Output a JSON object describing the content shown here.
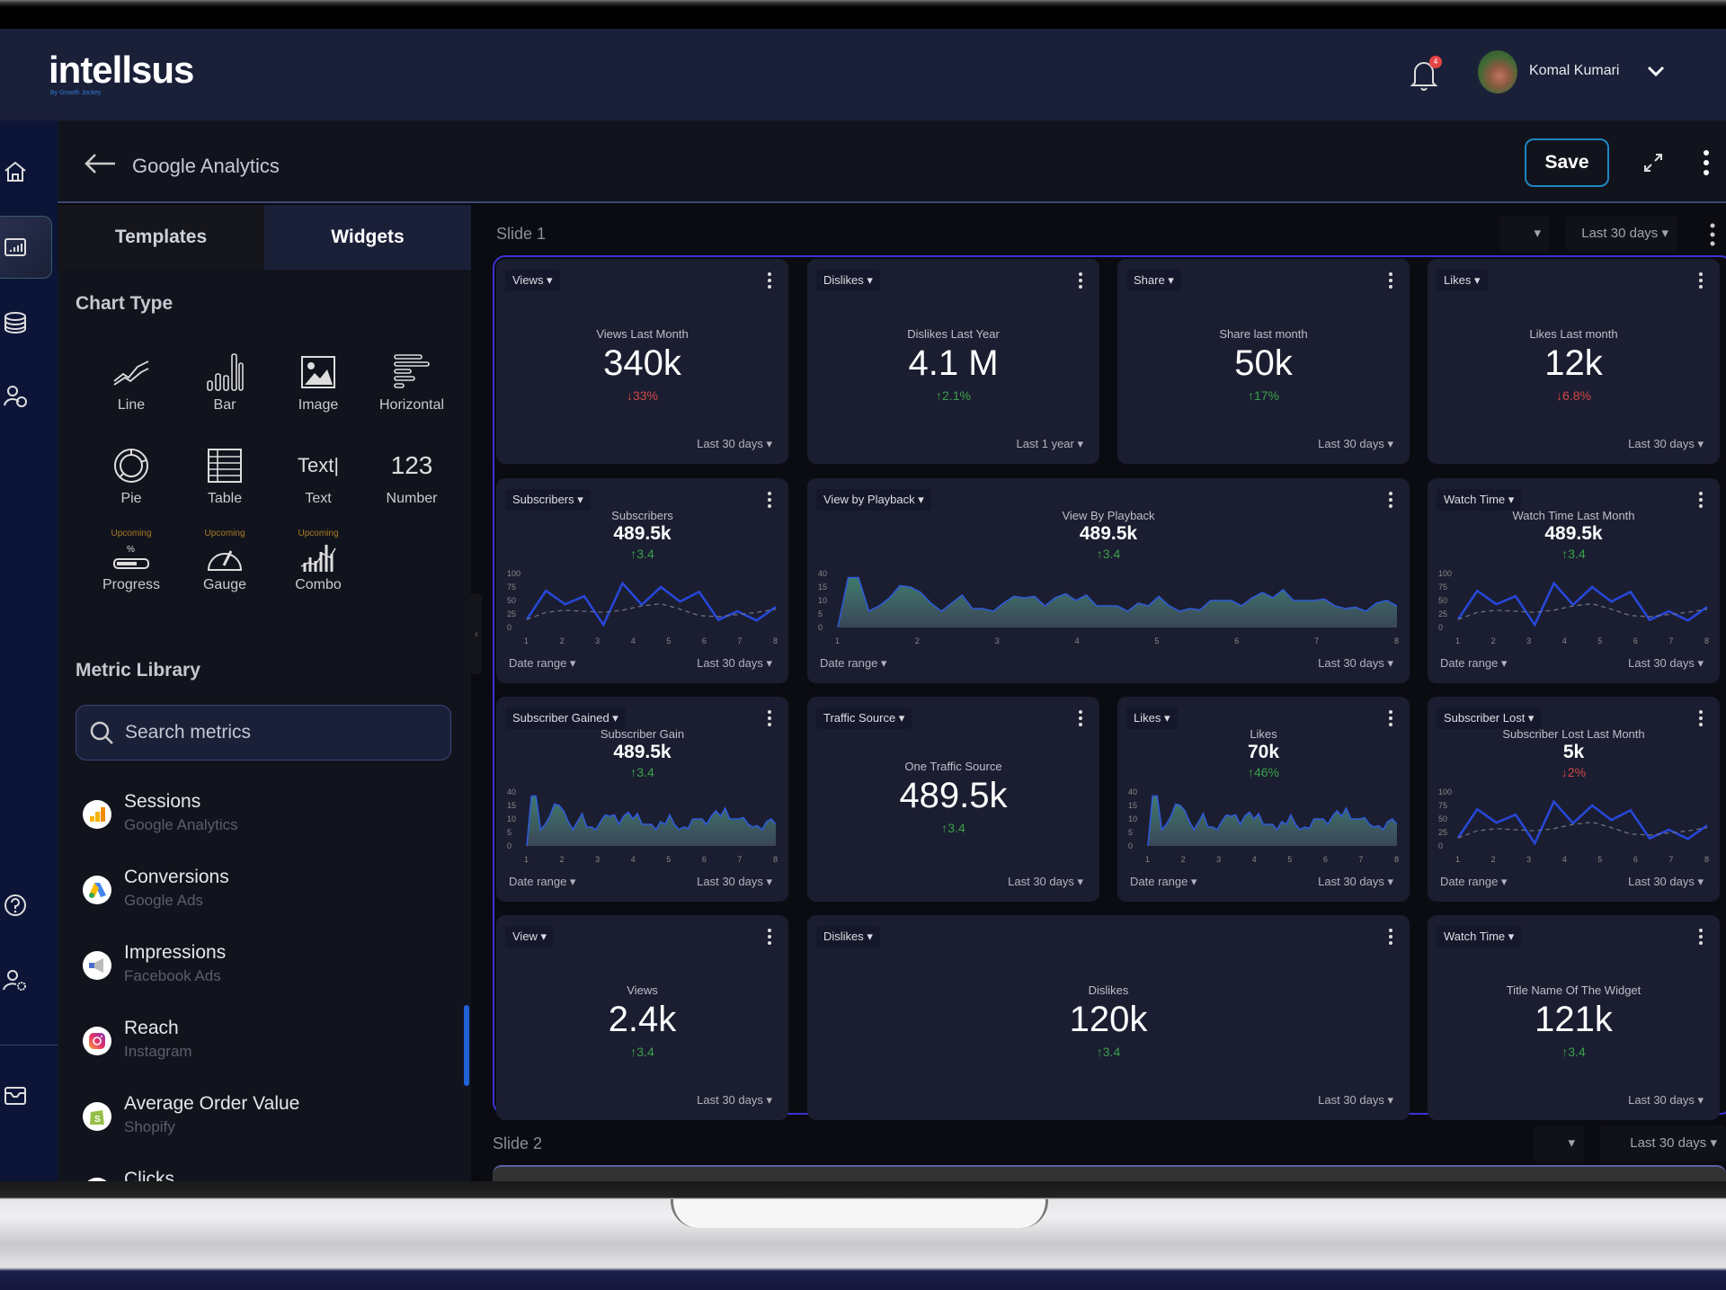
{
  "app": {
    "logo_text": "intellsus",
    "logo_sub": "By Growth Jockey",
    "notification_count": "4",
    "user_name": "Komal Kumari"
  },
  "header": {
    "title": "Google Analytics",
    "save_label": "Save"
  },
  "nav": {
    "items": [
      "home",
      "dashboards",
      "data-sources",
      "team",
      "help",
      "user-settings",
      "inbox"
    ],
    "active": "dashboards"
  },
  "left_panel": {
    "tabs": [
      {
        "label": "Templates",
        "active": false
      },
      {
        "label": "Widgets",
        "active": true
      }
    ],
    "chart_type_title": "Chart Type",
    "chart_types": [
      {
        "label": "Line",
        "icon": "line-chart-icon",
        "upcoming": ""
      },
      {
        "label": "Bar",
        "icon": "bar-chart-icon",
        "upcoming": ""
      },
      {
        "label": "Image",
        "icon": "image-icon",
        "upcoming": ""
      },
      {
        "label": "Horizontal",
        "icon": "horizontal-bar-icon",
        "upcoming": ""
      },
      {
        "label": "Pie",
        "icon": "pie-chart-icon",
        "upcoming": ""
      },
      {
        "label": "Table",
        "icon": "table-icon",
        "upcoming": ""
      },
      {
        "label": "Text",
        "icon": "text-icon",
        "icon_text": "Text|",
        "upcoming": ""
      },
      {
        "label": "Number",
        "icon": "number-icon",
        "icon_text": "123",
        "upcoming": ""
      },
      {
        "label": "Progress",
        "icon": "progress-icon",
        "upcoming": "Upcoming"
      },
      {
        "label": "Gauge",
        "icon": "gauge-icon",
        "upcoming": "Upcoming"
      },
      {
        "label": "Combo",
        "icon": "combo-chart-icon",
        "upcoming": "Upcoming"
      }
    ],
    "metric_library_title": "Metric Library",
    "search_placeholder": "Search metrics",
    "metrics": [
      {
        "name": "Sessions",
        "source": "Google Analytics",
        "icon": "google-analytics-icon"
      },
      {
        "name": "Conversions",
        "source": "Google Ads",
        "icon": "google-ads-icon"
      },
      {
        "name": "Impressions",
        "source": "Facebook Ads",
        "icon": "facebook-ads-icon"
      },
      {
        "name": "Reach",
        "source": "Instagram",
        "icon": "instagram-icon"
      },
      {
        "name": "Average Order Value",
        "source": "Shopify",
        "icon": "shopify-icon"
      },
      {
        "name": "Clicks",
        "source": "",
        "icon": "clicks-icon"
      }
    ]
  },
  "slides": [
    {
      "title": "Slide 1",
      "filter_empty": "",
      "range": "Last 30 days"
    },
    {
      "title": "Slide 2",
      "filter_empty": "",
      "range": "Last 30 days"
    }
  ],
  "widgets": [
    {
      "tag": "Views",
      "title": "Views Last Month",
      "value": "340k",
      "change": "↓33%",
      "dir": "down",
      "range": "Last 30 days",
      "kind": "number"
    },
    {
      "tag": "Dislikes",
      "title": "Dislikes Last Year",
      "value": "4.1 M",
      "change": "↑2.1%",
      "dir": "up",
      "range": "Last 1 year",
      "kind": "number"
    },
    {
      "tag": "Share",
      "title": "Share last month",
      "value": "50k",
      "change": "↑17%",
      "dir": "up",
      "range": "Last 30 days",
      "kind": "number"
    },
    {
      "tag": "Likes",
      "title": "Likes Last month",
      "value": "12k",
      "change": "↓6.8%",
      "dir": "down",
      "range": "Last 30 days",
      "kind": "number"
    },
    {
      "tag": "Subscribers",
      "title": "Subscribers",
      "value": "489.5k",
      "change": "↑3.4",
      "dir": "up",
      "range": "Last 30 days",
      "date_range": "Date range",
      "kind": "line"
    },
    {
      "tag": "View by Playback",
      "title": "View By Playback",
      "value": "489.5k",
      "change": "↑3.4",
      "dir": "up",
      "range": "Last 30 days",
      "date_range": "Date range",
      "kind": "area"
    },
    {
      "tag": "Watch Time",
      "title": "Watch Time Last Month",
      "value": "489.5k",
      "change": "↑3.4",
      "dir": "up",
      "range": "Last 30 days",
      "date_range": "Date range",
      "kind": "line"
    },
    {
      "tag": "Subscriber Gained",
      "title": "Subscriber Gain",
      "value": "489.5k",
      "change": "↑3.4",
      "dir": "up",
      "range": "Last 30 days",
      "date_range": "Date range",
      "kind": "area"
    },
    {
      "tag": "Traffic Source",
      "title": "One Traffic Source",
      "value": "489.5k",
      "change": "↑3.4",
      "dir": "up",
      "range": "Last 30 days",
      "kind": "number"
    },
    {
      "tag": "Likes",
      "title": "Likes",
      "value": "70k",
      "change": "↑46%",
      "dir": "up",
      "range": "Last 30 days",
      "date_range": "Date range",
      "kind": "area"
    },
    {
      "tag": "Subscriber Lost",
      "title": "Subscriber Lost Last Month",
      "value": "5k",
      "change": "↓2%",
      "dir": "down",
      "range": "Last 30 days",
      "date_range": "Date range",
      "kind": "line"
    },
    {
      "tag": "View",
      "title": "Views",
      "value": "2.4k",
      "change": "↑3.4",
      "dir": "up",
      "range": "Last 30 days",
      "kind": "number"
    },
    {
      "tag": "Dislikes",
      "title": "Dislikes",
      "value": "120k",
      "change": "↑3.4",
      "dir": "up",
      "range": "Last 30 days",
      "kind": "number"
    },
    {
      "tag": "Watch Time",
      "title": "Title Name Of The Widget",
      "value": "121k",
      "change": "↑3.4",
      "dir": "up",
      "range": "Last 30 days",
      "kind": "number"
    }
  ],
  "chart_data": [
    {
      "type": "line",
      "name": "line-widget-series",
      "x_ticks": [
        "1",
        "2",
        "3",
        "4",
        "5",
        "6",
        "7",
        "8"
      ],
      "y_ticks": [
        "0",
        "25",
        "50",
        "75",
        "100"
      ],
      "ylim": [
        0,
        100
      ],
      "series": [
        {
          "name": "current",
          "values": [
            15,
            68,
            43,
            58,
            5,
            82,
            42,
            75,
            48,
            66,
            14,
            30,
            13,
            38
          ]
        },
        {
          "name": "previous",
          "dashed": true,
          "values": [
            15,
            28,
            32,
            30,
            28,
            32,
            40,
            44,
            34,
            22,
            20,
            24,
            28,
            34
          ]
        }
      ]
    },
    {
      "type": "area",
      "name": "area-widget-series",
      "x_ticks": [
        "1",
        "2",
        "3",
        "4",
        "5",
        "6",
        "7",
        "8"
      ],
      "y_ticks": [
        "0",
        "5",
        "10",
        "15",
        "40"
      ],
      "ylim": [
        0,
        20
      ],
      "values": [
        0,
        18.5,
        18.5,
        6,
        8,
        11,
        15.5,
        15,
        13,
        9,
        6,
        9,
        12,
        7,
        7,
        6,
        9,
        11.5,
        11,
        11.5,
        8,
        11,
        12.5,
        10,
        12,
        8,
        8,
        8,
        6,
        9,
        8,
        11.5,
        8,
        6,
        7,
        6.5,
        10,
        10,
        10,
        8,
        11,
        13,
        11,
        14,
        10,
        10,
        10,
        10.5,
        8,
        7,
        7.5,
        6,
        9,
        10,
        8
      ]
    }
  ]
}
